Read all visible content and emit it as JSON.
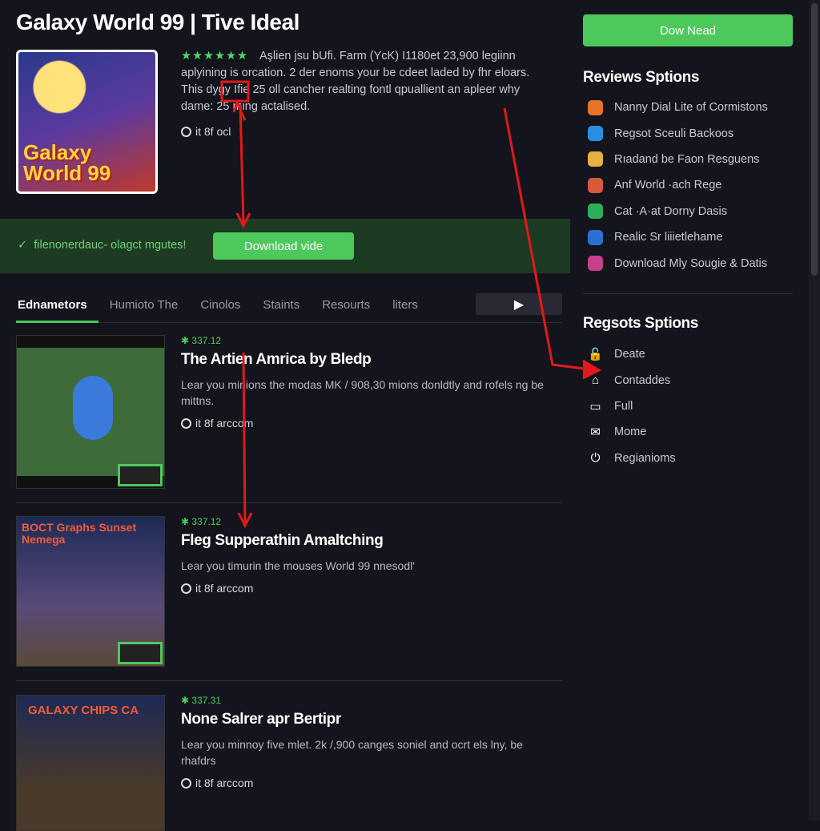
{
  "page_title": "Galaxy World 99 | Tive Ideal",
  "hero": {
    "image_logo": "Galaxy World 99",
    "stars": "★★★★★★",
    "description": "Aşlien jsu bUfi. Farm (YcK) I1180et 23,900 legiinn aplyining is orcation. 2 der enoms your be cdeet laded by fhr eloars. This dygy Ifie 25 oll cancher realting fontl qpuallient an apleer why dame: 25 ming actalised.",
    "meta": "it 8f ocl"
  },
  "banner": {
    "message": "filenonerdauc- olagct mgutes!",
    "button": "Download vide",
    "accent": "#4cc95a"
  },
  "tabs": [
    {
      "label": "Ednametors",
      "active": true
    },
    {
      "label": "Humioto The"
    },
    {
      "label": "Cinolos"
    },
    {
      "label": "Staints"
    },
    {
      "label": "Resourts"
    },
    {
      "label": "liters"
    }
  ],
  "play_icon": "play-icon",
  "items": [
    {
      "version": "337.12",
      "title": "The Artien Amrica by Bledp",
      "text": "Lear you minions the modas MK / 908,30 mions donldtly and rofels ng be mittns.",
      "meta": "it 8f arccom"
    },
    {
      "version": "337.12",
      "title": "Fleg Supperathin Amaltching",
      "text": "Lear you timurin the mouses World 99 nnesodl'",
      "meta": "it 8f arccom",
      "thumb_text": "BOCT Graphs Sunset Nemega"
    },
    {
      "version": "337.31",
      "title": "None Salrer apr Bertipr",
      "text": "Lear you minnoy five mlet. 2k /,900 canges soniel and ocrt els lny, be rhafdrs",
      "meta": "it 8f arccom",
      "thumb_text": "GALAXY CHIPS CA"
    }
  ],
  "sidebar": {
    "download_button": "Dow Nead",
    "reviews_heading": "Reviews Sptions",
    "reviews": [
      {
        "label": "Nanny Dial Lite of Cormistons",
        "icon": "app-icon",
        "color": "#e8722a"
      },
      {
        "label": "Regsot Sceuli Backoos",
        "icon": "twitter-icon",
        "color": "#2a8fe0"
      },
      {
        "label": "Rıadand be Faon Resguens",
        "icon": "coin-icon",
        "color": "#e8b040"
      },
      {
        "label": "Anf World ·ach Rege",
        "icon": "game-icon",
        "color": "#d85a3a"
      },
      {
        "label": "Cat ·A·at Dorny Dasis",
        "icon": "chat-icon",
        "color": "#2fae5a"
      },
      {
        "label": "Realic Sr liiietlehame",
        "icon": "game-icon",
        "color": "#2a70d0"
      },
      {
        "label": "Download Mly Sougie & Datis",
        "icon": "instagram-icon",
        "color": "#c6408a"
      }
    ],
    "options_heading": "Regsots Sptions",
    "options": [
      {
        "label": "Deate",
        "icon": "lock-icon",
        "glyph": "🔓"
      },
      {
        "label": "Contaddes",
        "icon": "home-icon",
        "glyph": "⌂"
      },
      {
        "label": "Full",
        "icon": "folder-icon",
        "glyph": "▭"
      },
      {
        "label": "Mome",
        "icon": "mail-icon",
        "glyph": "✉"
      },
      {
        "label": "Regianioms",
        "icon": "power-icon",
        "glyph": "⏻"
      }
    ]
  },
  "annotation_color": "#e01a1a"
}
